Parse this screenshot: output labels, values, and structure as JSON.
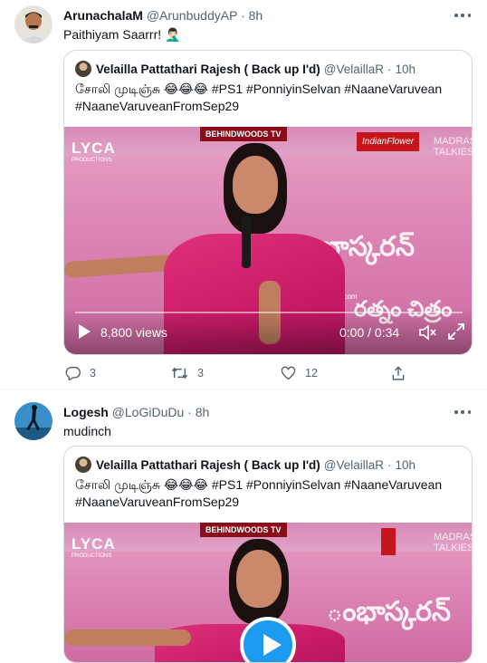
{
  "tweets": [
    {
      "name": "ArunachalaM",
      "handle": "@ArunbuddyAP",
      "dot": "·",
      "time": "8h",
      "text": "Paithiyam Saarrr! 🤦🏻‍♂️",
      "quote": {
        "name": "Velailla Pattathari Rajesh ( Back up I'd)",
        "handle": "@VelaillaR",
        "dot": "·",
        "time": "10h",
        "text": "சோலி முடிஞ்சு 😂😂😂 #PS1 #PonniyinSelvan #NaaneVaruvean #NaaneVaruveanFromSep29",
        "video": {
          "views": "8,800 views",
          "timecode": "0:00 / 0:34",
          "progress": 0.0,
          "overlay": {
            "lyca": "LYCA",
            "lyca_sub": "PRODUCTIONS",
            "behindwoods": "BEHINDWOODS TV",
            "indianflower": "IndianFlower",
            "madras": "MADRAS",
            "talkies": "TALKIES",
            "telugu1": "ంభాస్కరన్",
            "telugu2": "రత్నం చిత్రం",
            "url": "www.behindwoods.com"
          }
        }
      },
      "actions": {
        "replies": "3",
        "retweets": "3",
        "likes": "12"
      }
    },
    {
      "name": "Logesh",
      "handle": "@LoGiDuDu",
      "dot": "·",
      "time": "8h",
      "text": "mudinch",
      "quote": {
        "name": "Velailla Pattathari Rajesh ( Back up I'd)",
        "handle": "@VelaillaR",
        "dot": "·",
        "time": "10h",
        "text": "சோலி முடிஞ்சு 😂😂😂 #PS1 #PonniyinSelvan #NaaneVaruvean #NaaneVaruveanFromSep29",
        "video": {
          "overlay": {
            "lyca": "LYCA",
            "lyca_sub": "PRODUCTIONS",
            "behindwoods": "BEHINDWOODS TV",
            "madras": "MADRAS",
            "talkies": "TALKIES",
            "telugu1": "ంభాస్కరన్"
          }
        }
      }
    }
  ],
  "colors": {
    "text": "#0f1419",
    "secondary": "#536471",
    "accent": "#1d9bf0",
    "border": "#cfd9de"
  },
  "icons": {
    "reply": "reply-icon",
    "retweet": "retweet-icon",
    "like": "heart-icon",
    "share": "share-icon",
    "more": "more-icon",
    "play": "play-icon",
    "volume": "volume-icon",
    "fullscreen": "fullscreen-icon"
  }
}
